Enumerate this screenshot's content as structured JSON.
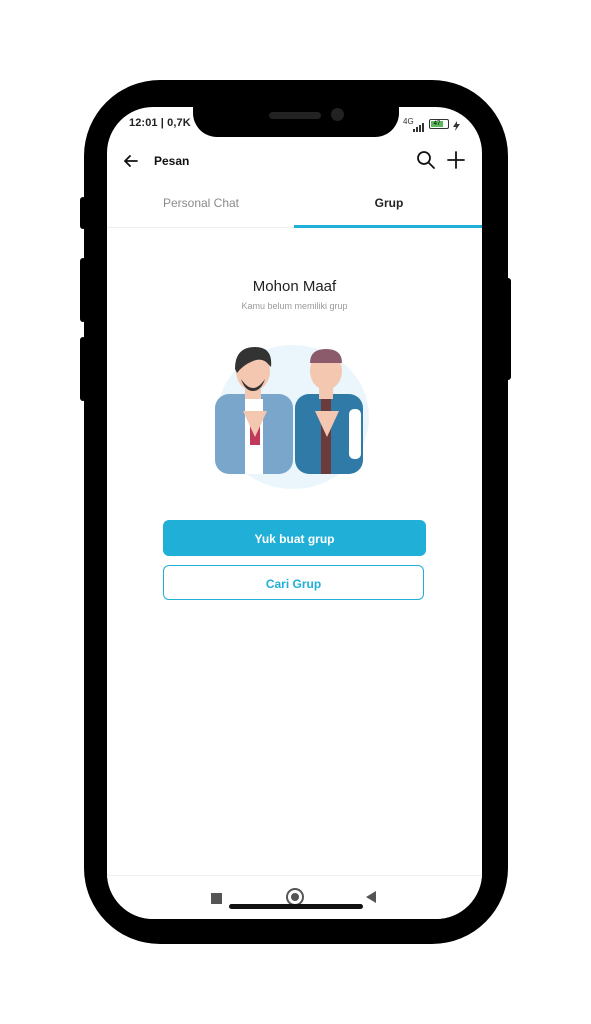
{
  "status_bar": {
    "time": "12:01 | 0,7K",
    "network": "4G",
    "battery": "47"
  },
  "header": {
    "title": "Pesan"
  },
  "tabs": [
    {
      "label": "Personal Chat",
      "active": false
    },
    {
      "label": "Grup",
      "active": true
    }
  ],
  "empty_state": {
    "title": "Mohon Maaf",
    "subtitle": "Kamu belum memiliki grup"
  },
  "actions": {
    "create_group_label": "Yuk buat grup",
    "find_group_label": "Cari Grup"
  },
  "colors": {
    "accent": "#20afd6",
    "text": "#222222",
    "muted": "#9a9a9a"
  },
  "icons": [
    "back-arrow-icon",
    "search-icon",
    "plus-icon",
    "nav-square-icon",
    "nav-home-icon",
    "nav-back-icon"
  ]
}
